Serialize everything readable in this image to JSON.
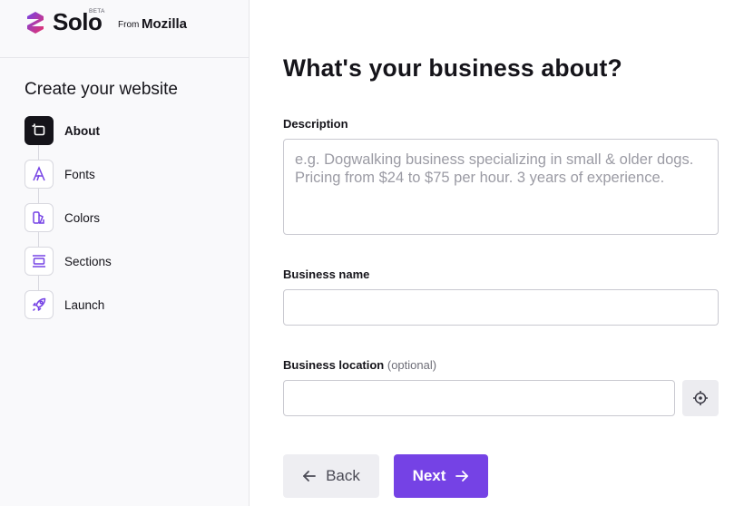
{
  "brand": {
    "name": "Solo",
    "badge": "BETA",
    "from_label": "From",
    "company": "Mozilla"
  },
  "sidebar": {
    "title": "Create your website",
    "steps": [
      {
        "label": "About",
        "icon": "crop-icon",
        "active": true
      },
      {
        "label": "Fonts",
        "icon": "font-icon",
        "active": false
      },
      {
        "label": "Colors",
        "icon": "palette-icon",
        "active": false
      },
      {
        "label": "Sections",
        "icon": "sections-icon",
        "active": false
      },
      {
        "label": "Launch",
        "icon": "rocket-icon",
        "active": false
      }
    ]
  },
  "main": {
    "heading": "What's your business about?",
    "description": {
      "label": "Description",
      "placeholder": "e.g. Dogwalking business specializing in small & older dogs. Pricing from $24 to $75 per hour. 3 years of experience.",
      "value": ""
    },
    "business_name": {
      "label": "Business name",
      "value": ""
    },
    "business_location": {
      "label": "Business location",
      "optional_note": "(optional)",
      "value": "",
      "locate_icon": "crosshair-icon"
    },
    "buttons": {
      "back": "Back",
      "next": "Next"
    }
  },
  "colors": {
    "accent": "#7542e5",
    "text": "#15141a",
    "sidebar_bg": "#f9f9fb",
    "logo_pink": "#e9326b",
    "logo_purple": "#7542e5"
  }
}
